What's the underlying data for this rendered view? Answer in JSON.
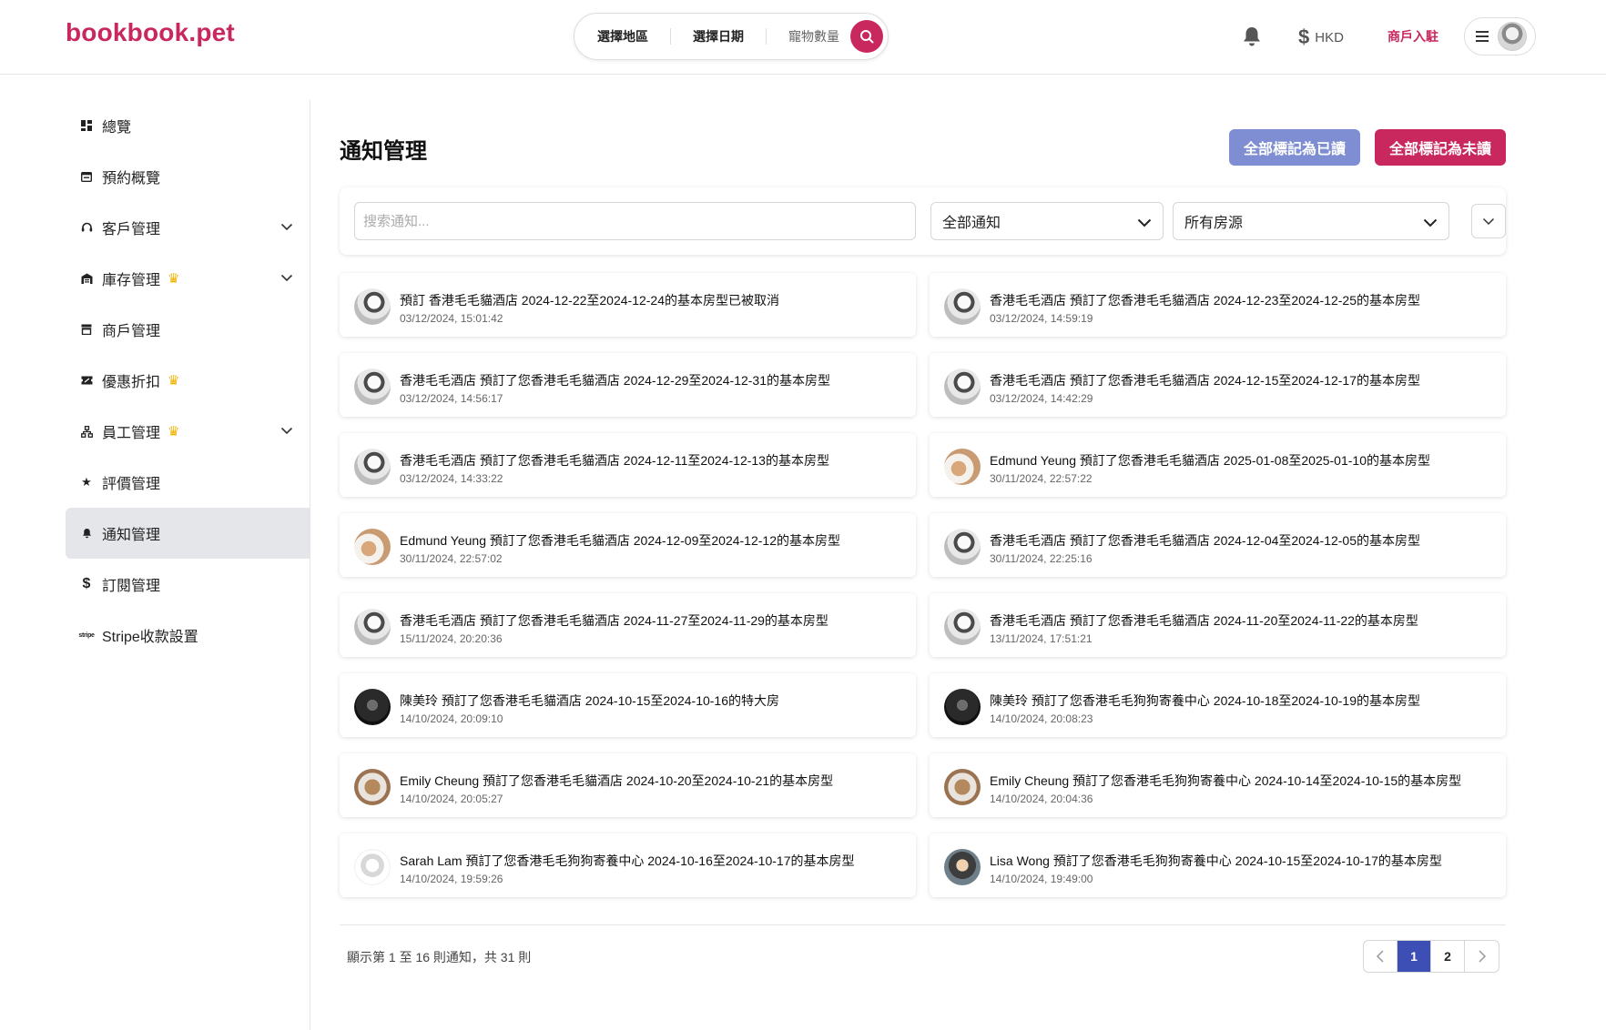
{
  "header": {
    "logo": "bookbook.pet",
    "search": {
      "region": "選擇地區",
      "date": "選擇日期",
      "pets": "寵物數量"
    },
    "currency": "HKD",
    "merchant_link": "商戶入駐"
  },
  "sidebar": {
    "items": [
      {
        "label": "總覽",
        "icon": "dashboard-icon",
        "crown": false,
        "chevron": false,
        "active": false
      },
      {
        "label": "預約概覽",
        "icon": "calendar-icon",
        "crown": false,
        "chevron": false,
        "active": false
      },
      {
        "label": "客戶管理",
        "icon": "headset-icon",
        "crown": false,
        "chevron": true,
        "active": false
      },
      {
        "label": "庫存管理",
        "icon": "warehouse-icon",
        "crown": true,
        "chevron": true,
        "active": false
      },
      {
        "label": "商戶管理",
        "icon": "store-icon",
        "crown": false,
        "chevron": false,
        "active": false
      },
      {
        "label": "優惠折扣",
        "icon": "ticket-icon",
        "crown": true,
        "chevron": false,
        "active": false
      },
      {
        "label": "員工管理",
        "icon": "org-chart-icon",
        "crown": true,
        "chevron": true,
        "active": false
      },
      {
        "label": "評價管理",
        "icon": "star-icon",
        "crown": false,
        "chevron": false,
        "active": false
      },
      {
        "label": "通知管理",
        "icon": "bell-icon",
        "crown": false,
        "chevron": false,
        "active": true
      },
      {
        "label": "訂閱管理",
        "icon": "dollar-icon",
        "crown": false,
        "chevron": false,
        "active": false
      },
      {
        "label": "Stripe收款設置",
        "icon": "stripe-icon",
        "crown": false,
        "chevron": false,
        "active": false
      }
    ]
  },
  "main": {
    "title": "通知管理",
    "mark_all_read": "全部標記為已讀",
    "mark_all_unread": "全部標記為未讀",
    "filters": {
      "search_placeholder": "搜索通知...",
      "type_value": "全部通知",
      "property_value": "所有房源"
    },
    "notifications": [
      {
        "avatar": "cat",
        "title": "預訂 香港毛毛貓酒店 2024-12-22至2024-12-24的基本房型已被取消",
        "time": "03/12/2024, 15:01:42"
      },
      {
        "avatar": "cat",
        "title": "香港毛毛酒店 預訂了您香港毛毛貓酒店 2024-12-23至2024-12-25的基本房型",
        "time": "03/12/2024, 14:59:19"
      },
      {
        "avatar": "cat",
        "title": "香港毛毛酒店 預訂了您香港毛毛貓酒店 2024-12-29至2024-12-31的基本房型",
        "time": "03/12/2024, 14:56:17"
      },
      {
        "avatar": "cat",
        "title": "香港毛毛酒店 預訂了您香港毛毛貓酒店 2024-12-15至2024-12-17的基本房型",
        "time": "03/12/2024, 14:42:29"
      },
      {
        "avatar": "cat",
        "title": "香港毛毛酒店 預訂了您香港毛毛貓酒店 2024-12-11至2024-12-13的基本房型",
        "time": "03/12/2024, 14:33:22"
      },
      {
        "avatar": "dogs",
        "title": "Edmund Yeung 預訂了您香港毛毛貓酒店 2025-01-08至2025-01-10的基本房型",
        "time": "30/11/2024, 22:57:22"
      },
      {
        "avatar": "dogs",
        "title": "Edmund Yeung 預訂了您香港毛毛貓酒店 2024-12-09至2024-12-12的基本房型",
        "time": "30/11/2024, 22:57:02"
      },
      {
        "avatar": "cat",
        "title": "香港毛毛酒店 預訂了您香港毛毛貓酒店 2024-12-04至2024-12-05的基本房型",
        "time": "30/11/2024, 22:25:16"
      },
      {
        "avatar": "cat",
        "title": "香港毛毛酒店 預訂了您香港毛毛貓酒店 2024-11-27至2024-11-29的基本房型",
        "time": "15/11/2024, 20:20:36"
      },
      {
        "avatar": "cat",
        "title": "香港毛毛酒店 預訂了您香港毛毛貓酒店 2024-11-20至2024-11-22的基本房型",
        "time": "13/11/2024, 17:51:21"
      },
      {
        "avatar": "dark",
        "title": "陳美玲 預訂了您香港毛毛貓酒店 2024-10-15至2024-10-16的特大房",
        "time": "14/10/2024, 20:09:10"
      },
      {
        "avatar": "dark",
        "title": "陳美玲 預訂了您香港毛毛狗狗寄養中心 2024-10-18至2024-10-19的基本房型",
        "time": "14/10/2024, 20:08:23"
      },
      {
        "avatar": "couple",
        "title": "Emily Cheung 預訂了您香港毛毛貓酒店 2024-10-20至2024-10-21的基本房型",
        "time": "14/10/2024, 20:05:27"
      },
      {
        "avatar": "couple",
        "title": "Emily Cheung 預訂了您香港毛毛狗狗寄養中心 2024-10-14至2024-10-15的基本房型",
        "time": "14/10/2024, 20:04:36"
      },
      {
        "avatar": "dog",
        "title": "Sarah Lam 預訂了您香港毛毛狗狗寄養中心 2024-10-16至2024-10-17的基本房型",
        "time": "14/10/2024, 19:59:26"
      },
      {
        "avatar": "lisa",
        "title": "Lisa Wong 預訂了您香港毛毛狗狗寄養中心 2024-10-15至2024-10-17的基本房型",
        "time": "14/10/2024, 19:49:00"
      }
    ],
    "summary": "顯示第 1 至 16 則通知，共 31 則",
    "pagination": {
      "pages": [
        "1",
        "2"
      ],
      "current": "1"
    }
  },
  "colors": {
    "brand": "#c8285d",
    "mark_read_button": "#7f8ed3",
    "active_page": "#3d4eb5",
    "crown": "#f0b400"
  }
}
